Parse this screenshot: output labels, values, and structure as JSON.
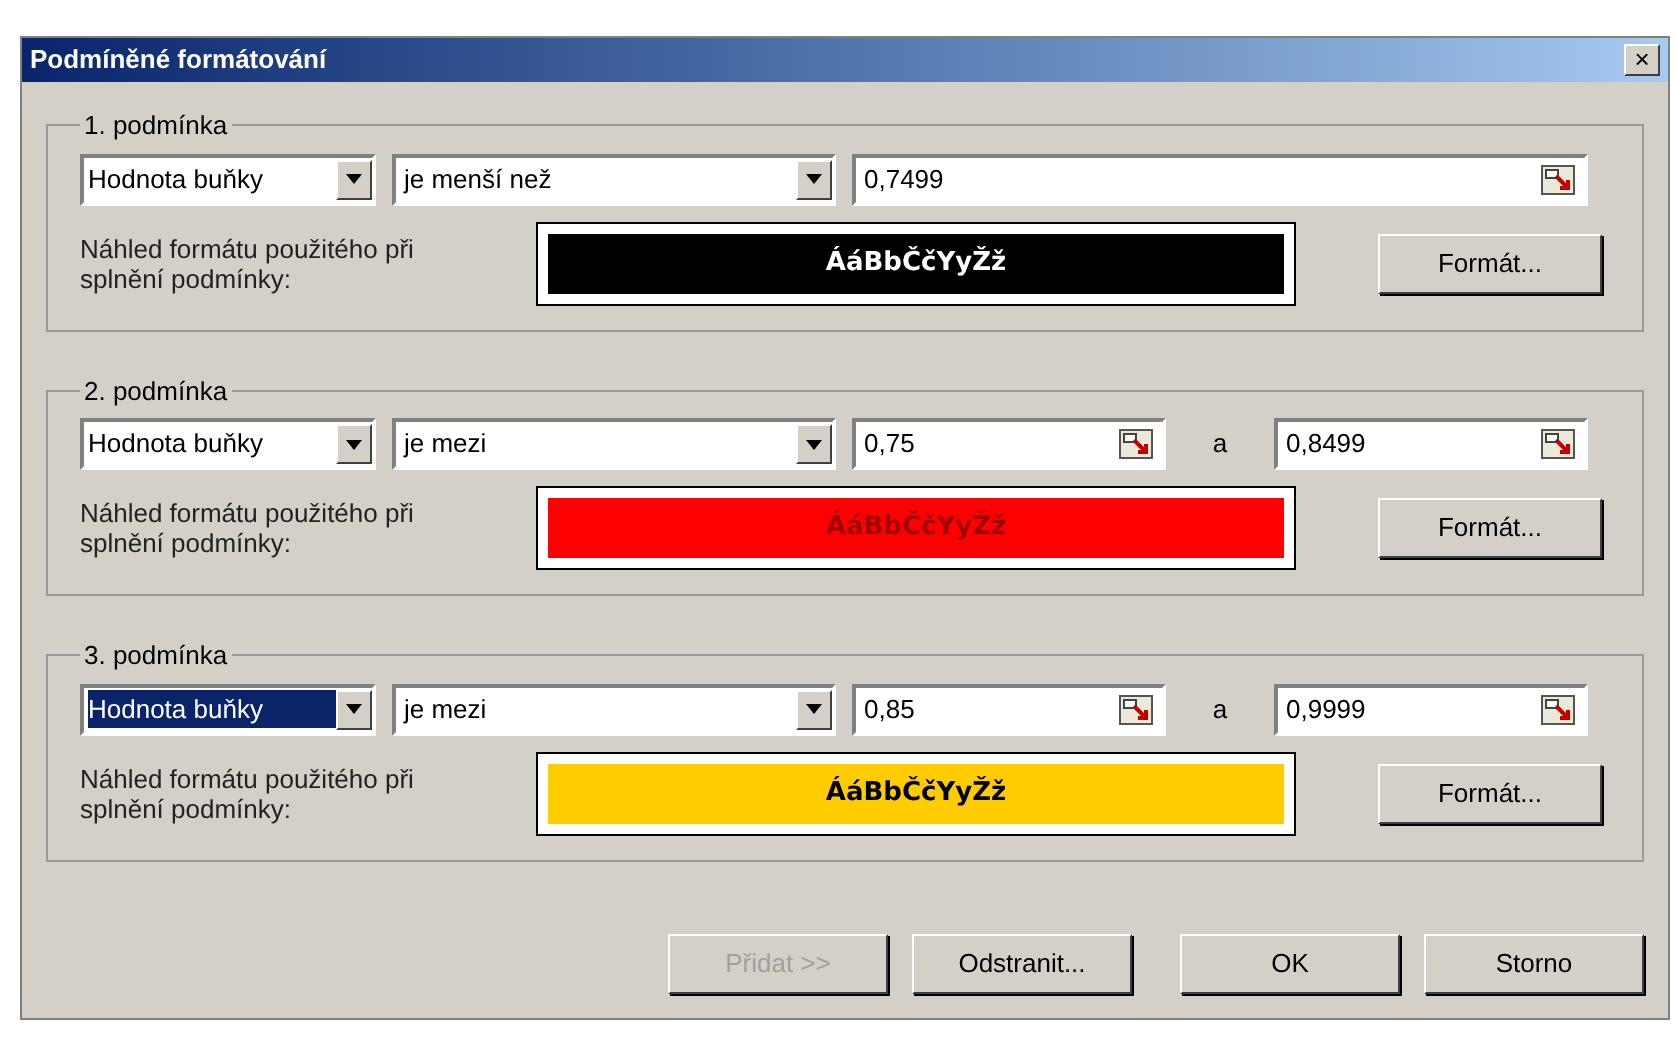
{
  "window": {
    "title": "Podmíněné formátování",
    "close": "×"
  },
  "conditions": [
    {
      "legend": "1. podmínka",
      "kind": "single",
      "source": {
        "value": "Hodnota buňky",
        "focused": false
      },
      "operator": "je menší než",
      "values": [
        "0,7499"
      ],
      "preview_label": "Náhled formátu použitého při splnění podmínky:",
      "preview": {
        "color": "#000000",
        "sample": {
          "text": "ÁáBbČčYyŽž",
          "color": "#ffffff"
        }
      },
      "format_button": "Formát..."
    },
    {
      "legend": "2. podmínka",
      "kind": "between",
      "source": {
        "value": "Hodnota buňky",
        "focused": false
      },
      "operator": "je mezi",
      "values": [
        "0,75",
        "0,8499"
      ],
      "joiner": "a",
      "preview_label": "Náhled formátu použitého při splnění podmínky:",
      "preview": {
        "color": "#ff0000",
        "sample": {
          "text": "ÁáBbČčYyŽž",
          "color": "#a00000"
        }
      },
      "format_button": "Formát..."
    },
    {
      "legend": "3. podmínka",
      "kind": "between",
      "source": {
        "value": "Hodnota buňky",
        "focused": true
      },
      "operator": "je mezi",
      "values": [
        "0,85",
        "0,9999"
      ],
      "joiner": "a",
      "preview_label": "Náhled formátu použitého při splnění podmínky:",
      "preview": {
        "color": "#ffcc00",
        "sample": {
          "text": "ÁáBbČčYyŽž",
          "color": "#000000"
        }
      },
      "format_button": "Formát..."
    }
  ],
  "buttons": [
    {
      "label": "Přidat >>",
      "disabled": true
    },
    {
      "label": "Odstranit...",
      "disabled": false
    },
    {
      "label": "OK",
      "disabled": false
    },
    {
      "label": "Storno",
      "disabled": false
    }
  ]
}
